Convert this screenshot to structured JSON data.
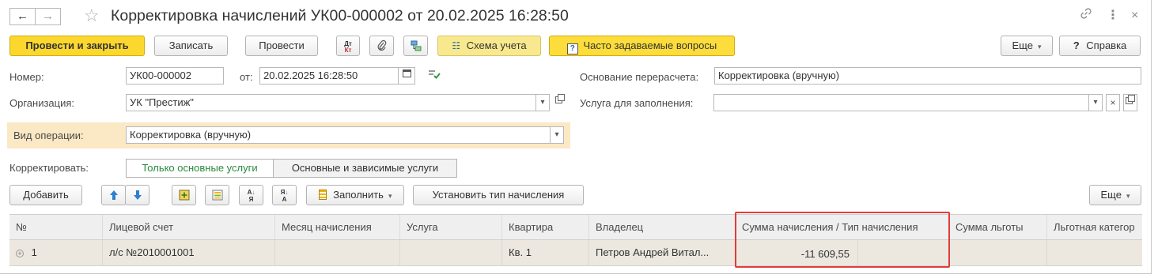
{
  "window": {
    "title": "Корректировка начислений УК00-000002 от 20.02.2025 16:28:50",
    "back_icon": "←",
    "forward_icon": "→",
    "star_icon": "☆",
    "link_icon": "🔗",
    "more_icon": "⋮",
    "close_icon": "×"
  },
  "toolbar": {
    "post_close": "Провести и закрыть",
    "save": "Записать",
    "post": "Провести",
    "scheme": "Схема учета",
    "faq": "Часто задаваемые вопросы",
    "more": "Еще",
    "help": "Справка",
    "help_q": "?"
  },
  "fields": {
    "number_label": "Номер:",
    "number_value": "УК00-000002",
    "date_label": "от:",
    "date_value": "20.02.2025 16:28:50",
    "basis_label": "Основание перерасчета:",
    "basis_value": "Корректировка (вручную)",
    "org_label": "Организация:",
    "org_value": "УК \"Престиж\"",
    "service_label": "Услуга для заполнения:",
    "service_value": "",
    "op_label": "Вид операции:",
    "op_value": "Корректировка (вручную)",
    "correct_label": "Корректировать:",
    "correct_opt1": "Только основные услуги",
    "correct_opt2": "Основные и зависимые услуги"
  },
  "table_toolbar": {
    "add": "Добавить",
    "fill": "Заполнить",
    "set_type": "Установить тип начисления",
    "more": "Еще"
  },
  "table": {
    "columns": [
      "№",
      "Лицевой счет",
      "Месяц начисления",
      "Услуга",
      "Квартира",
      "Владелец",
      "Сумма начисления / Тип начисления",
      "Сумма льготы",
      "Льготная категор"
    ],
    "rows": [
      {
        "num": "1",
        "account": "л/с №2010001001",
        "month": "",
        "service": "",
        "flat": "Кв. 1",
        "owner": "Петров Андрей Витал...",
        "amount": "-11 609,55",
        "type": "",
        "benefit": "",
        "category": ""
      }
    ]
  },
  "colors": {
    "accent_yellow": "#fcd82f",
    "highlight_orange": "#fbe8c4",
    "selected_green": "#2a8a3e",
    "red_frame": "#e03c3c"
  }
}
